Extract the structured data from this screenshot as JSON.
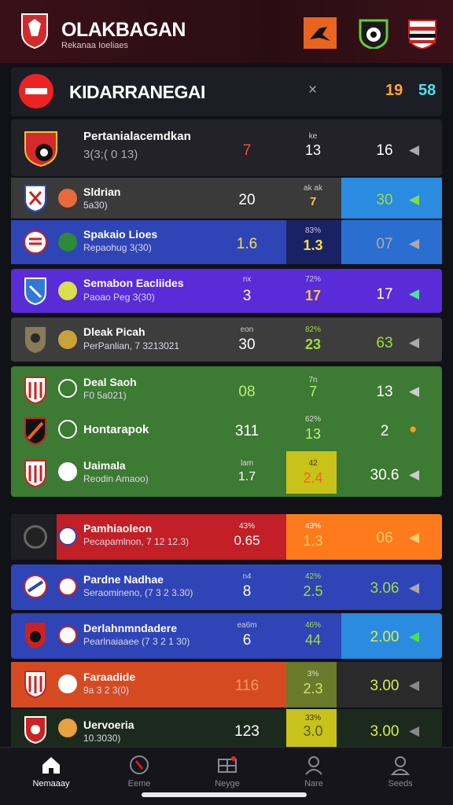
{
  "header": {
    "title": "OLAKBAGAN",
    "subtitle": "Rekanaa Ioeliaes"
  },
  "section": {
    "title": "KIDARRANEGAI",
    "close_symbol": "×",
    "count_a": "19",
    "count_b": "58"
  },
  "colors": {
    "orange": "#ff7a1c",
    "red": "#c9212a",
    "blue": "#2f44b7",
    "purple": "#5a2bd8",
    "green": "#3d7a33"
  },
  "matches": [
    {
      "name": "Pertanialacemdkan",
      "sub": "3(3;( 0 13)",
      "v1": "7",
      "odds_label": "ke",
      "v2": "13",
      "v3": "16"
    },
    {
      "name": "Sldrian",
      "sub": "5a30)",
      "v1": "20",
      "odds_label": "ak ak",
      "v2": "7",
      "v3": "30"
    },
    {
      "name": "Spakaio Lioes",
      "sub": "Repaohug 3(30)",
      "v1": "1.6",
      "odds_label": "83%",
      "v2": "1.3",
      "v3": "07"
    },
    {
      "name": "Semabon Eacliides",
      "sub": "Paoao Peg 3(30)",
      "v1": "3",
      "odds_label": "72%",
      "v1_label": "nx",
      "v2": "17",
      "v3": "17"
    },
    {
      "name": "Dleak Picah",
      "sub": "PerPanlian, 7 3213021",
      "v1": "30",
      "v1_label": "eon",
      "odds_label": "82%",
      "v2": "23",
      "v3": "63"
    },
    {
      "name": "Deal Saoh",
      "sub": "F0 5a021)",
      "v1": "08",
      "odds_label": "7n",
      "v2": "7",
      "v3": "13"
    },
    {
      "name": "Hontarapok",
      "sub": "",
      "v1": "311",
      "odds_label": "62%",
      "v2": "13",
      "v3": "2"
    },
    {
      "name": "Uaimala",
      "sub": "Reodin Amaoo)",
      "v1": "1.7",
      "v1_label": "lam",
      "odds_label": "42",
      "v2": "2.4",
      "v3": "30.6"
    },
    {
      "name": "Pamhiaoleon",
      "sub": "Pecapamlnon, 7 12 12.3)",
      "v1": "0.65",
      "v1_label": "43%",
      "odds_label": "43%",
      "v2": "1.3",
      "v3": "06"
    },
    {
      "name": "Pardne Nadhae",
      "sub": "Seraomineno, (7 3 2 3.30)",
      "v1": "8",
      "v1_label": "n4",
      "odds_label": "42%",
      "v2": "2.5",
      "v3": "3.06"
    },
    {
      "name": "Derlahnmndadere",
      "sub": "Pearlnaiaaee (7 3 2 1 30)",
      "v1": "6",
      "v1_label": "ea6m",
      "odds_label": "46%",
      "v2": "44",
      "v3": "2.00"
    },
    {
      "name": "Faraadide",
      "sub": "9a 3 2 3(0)",
      "v1": "116",
      "odds_label": "3%",
      "v2": "2.3",
      "v3": "3.00"
    },
    {
      "name": "Uervoeria",
      "sub": "10.3030)",
      "v1": "123",
      "odds_label": "33%",
      "v2": "3.0",
      "v3": "3.00"
    }
  ],
  "tabs": [
    {
      "label": "Nemaaay",
      "icon": "home-icon"
    },
    {
      "label": "Eeme",
      "icon": "ball-icon"
    },
    {
      "label": "Neyge",
      "icon": "scoreboard-icon"
    },
    {
      "label": "Nare",
      "icon": "profile-icon"
    },
    {
      "label": "Seeds",
      "icon": "user-icon"
    }
  ]
}
